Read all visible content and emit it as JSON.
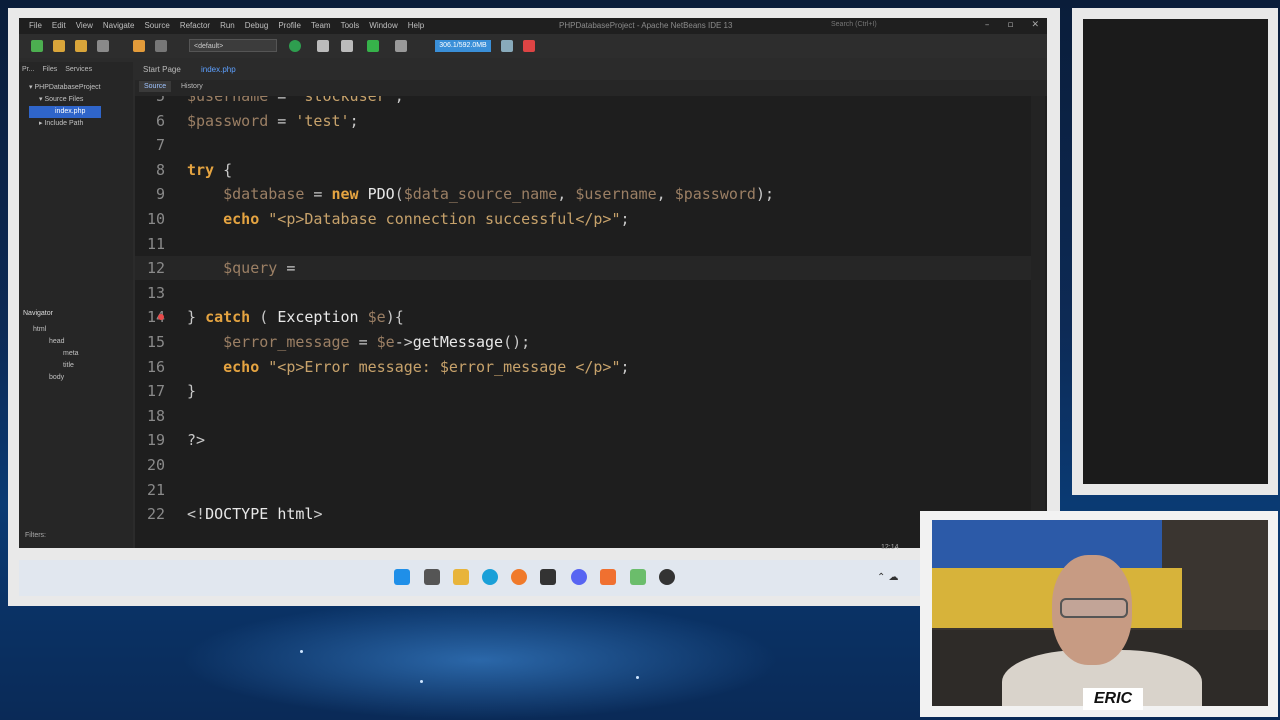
{
  "window": {
    "title": "PHPDatabaseProject - Apache NetBeans IDE 13",
    "search_placeholder": "Search (Ctrl+I)",
    "menu": [
      "File",
      "Edit",
      "View",
      "Navigate",
      "Source",
      "Refactor",
      "Run",
      "Debug",
      "Profile",
      "Team",
      "Tools",
      "Window",
      "Help"
    ]
  },
  "toolbar": {
    "config": "<default>",
    "memory": "306.1/592.0MB"
  },
  "left_panel": {
    "tabs": [
      "Pr...",
      "Files",
      "Services"
    ],
    "tree": [
      "PHPDatabaseProject",
      "Source Files",
      "index.php",
      "Include Path"
    ]
  },
  "navigator": {
    "title": "Navigator",
    "tree": [
      "html",
      "head",
      "meta",
      "title",
      "body"
    ],
    "filters_label": "Filters:"
  },
  "editor": {
    "tabs": [
      "Start Page",
      "index.php"
    ],
    "view_tabs": [
      "Source",
      "History"
    ],
    "lines": [
      {
        "n": "5",
        "t": "$username = 'stockuser';"
      },
      {
        "n": "6",
        "t": "$password = 'test';"
      },
      {
        "n": "7",
        "t": ""
      },
      {
        "n": "8",
        "t": "try {"
      },
      {
        "n": "9",
        "t": "    $database = new PDO($data_source_name, $username, $password);"
      },
      {
        "n": "10",
        "t": "    echo \"<p>Database connection successful</p>\";"
      },
      {
        "n": "11",
        "t": ""
      },
      {
        "n": "12",
        "t": "    $query ="
      },
      {
        "n": "13",
        "t": ""
      },
      {
        "n": "14",
        "t": "} catch ( Exception $e){"
      },
      {
        "n": "15",
        "t": "    $error_message = $e->getMessage();"
      },
      {
        "n": "16",
        "t": "    echo \"<p>Error message: $error_message </p>\";"
      },
      {
        "n": "17",
        "t": "}"
      },
      {
        "n": "18",
        "t": ""
      },
      {
        "n": "19",
        "t": "?>"
      },
      {
        "n": "20",
        "t": ""
      },
      {
        "n": "21",
        "t": ""
      },
      {
        "n": "22",
        "t": "<!DOCTYPE html>"
      }
    ],
    "cursor_pos": "12:14"
  },
  "webcam": {
    "name": "ERIC"
  },
  "colors": {
    "accent": "#2f65ca",
    "keyword": "#e5a441",
    "variable": "#9b7f64",
    "string": "#c7a26b"
  }
}
